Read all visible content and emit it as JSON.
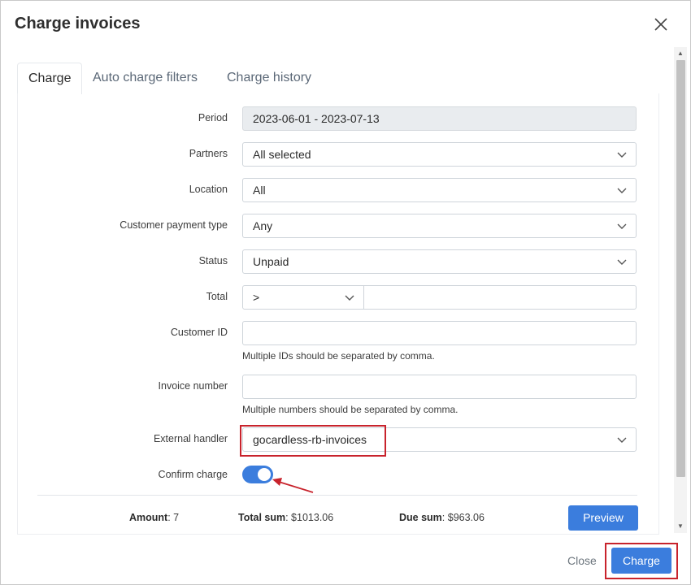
{
  "dialog": {
    "title": "Charge invoices",
    "close_icon": "close-icon"
  },
  "tabs": [
    {
      "label": "Charge",
      "active": true
    },
    {
      "label": "Auto charge filters",
      "active": false
    },
    {
      "label": "Charge history",
      "active": false
    }
  ],
  "form": {
    "period": {
      "label": "Period",
      "value": "2023-06-01 - 2023-07-13"
    },
    "partners": {
      "label": "Partners",
      "value": "All selected"
    },
    "location": {
      "label": "Location",
      "value": "All"
    },
    "payment_type": {
      "label": "Customer payment type",
      "value": "Any"
    },
    "status": {
      "label": "Status",
      "value": "Unpaid"
    },
    "total": {
      "label": "Total",
      "operator": ">",
      "value": ""
    },
    "customer_id": {
      "label": "Customer ID",
      "value": "",
      "hint": "Multiple IDs should be separated by comma."
    },
    "invoice_number": {
      "label": "Invoice number",
      "value": "",
      "hint": "Multiple numbers should be separated by comma."
    },
    "external_handler": {
      "label": "External handler",
      "value": "gocardless-rb-invoices"
    },
    "confirm_charge": {
      "label": "Confirm charge",
      "enabled": true
    }
  },
  "summary": {
    "amount_label": "Amount",
    "amount_value": ": 7",
    "total_label": "Total sum",
    "total_value": ": $1013.06",
    "due_label": "Due sum",
    "due_value": ": $963.06",
    "preview_label": "Preview"
  },
  "footer": {
    "close_label": "Close",
    "charge_label": "Charge"
  },
  "colors": {
    "primary": "#3b7ddd",
    "annotation": "#c8232c"
  }
}
